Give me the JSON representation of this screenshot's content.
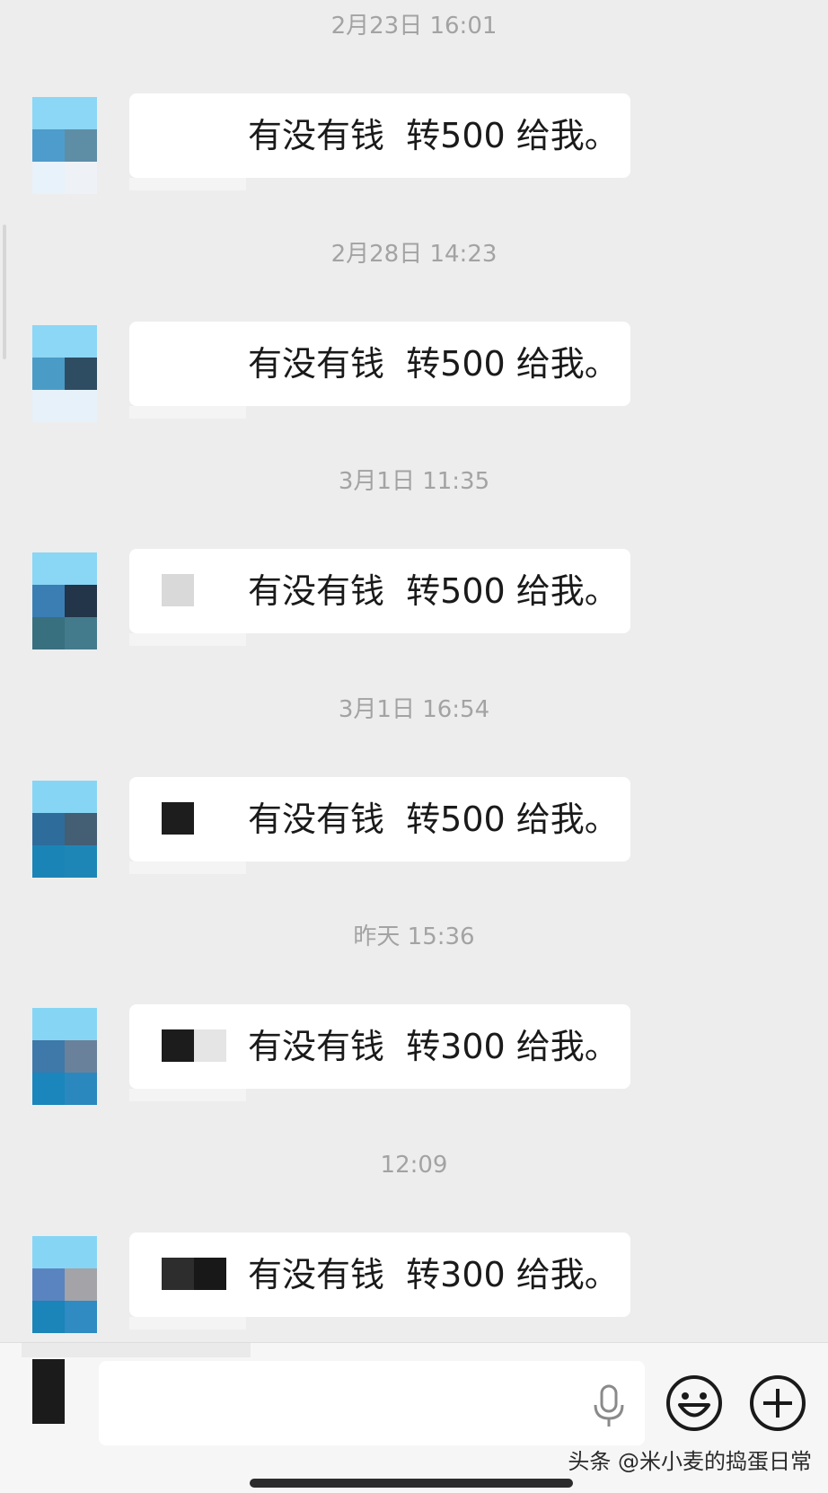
{
  "messages": [
    {
      "timestamp": "2月23日 16:01",
      "text": "有没有钱  转500 给我。",
      "avatar_colors": [
        "#8cd6f6",
        "#8cd6f6",
        "#4e9ccb",
        "#5e8ea6",
        "#e8f2fa",
        "#eef2f6"
      ],
      "redact_blocks": []
    },
    {
      "timestamp": "2月28日 14:23",
      "text": "有没有钱  转500 给我。",
      "avatar_colors": [
        "#8cd6f6",
        "#8cd6f6",
        "#4a9cc7",
        "#2e4d62",
        "#e6f1f9",
        "#e6f1f9"
      ],
      "redact_blocks": []
    },
    {
      "timestamp": "3月1日 11:35",
      "text": "有没有钱  转500 给我。",
      "avatar_colors": [
        "#89d6f5",
        "#89d6f5",
        "#3b7eb3",
        "#233548",
        "#39707f",
        "#437a8c"
      ],
      "redact_blocks": [
        "#d9d9d9"
      ]
    },
    {
      "timestamp": "3月1日 16:54",
      "text": "有没有钱  转500 给我。",
      "avatar_colors": [
        "#87d5f5",
        "#87d5f5",
        "#2e6c9c",
        "#445e73",
        "#1b84b6",
        "#1e86b6"
      ],
      "redact_blocks": [
        "#1d1d1d"
      ]
    },
    {
      "timestamp": "昨天 15:36",
      "text": "有没有钱  转300 给我。",
      "avatar_colors": [
        "#87d5f5",
        "#87d5f5",
        "#3e79aa",
        "#6a819b",
        "#1b86bc",
        "#2b88be"
      ],
      "redact_blocks": [
        "#1c1c1c",
        "#e5e5e5"
      ]
    },
    {
      "timestamp": "12:09",
      "text": "有没有钱  转300 给我。",
      "avatar_colors": [
        "#87d5f5",
        "#87d5f5",
        "#5a84c0",
        "#a3a3a8",
        "#1b84b8",
        "#2f8bc1"
      ],
      "redact_blocks": [
        "#2d2d2d",
        "#181818"
      ]
    }
  ],
  "input": {
    "value": "",
    "placeholder": ""
  },
  "icons": {
    "voice": "mic-icon",
    "emoji": "emoji-icon",
    "more": "plus-icon"
  },
  "watermark": "头条 @米小麦的捣蛋日常"
}
